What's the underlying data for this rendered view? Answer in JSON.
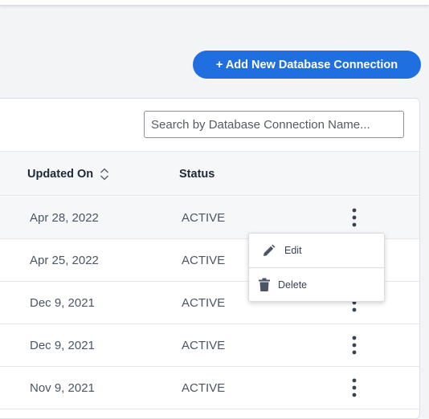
{
  "toolbar": {
    "add_label": "+ Add New Database Connection"
  },
  "search": {
    "placeholder": "Search by Database Connection Name..."
  },
  "table": {
    "columns": {
      "updated_on": "Updated On",
      "status": "Status"
    },
    "rows": [
      {
        "updated_on": "Apr 28, 2022",
        "status": "ACTIVE"
      },
      {
        "updated_on": "Apr 25, 2022",
        "status": "ACTIVE"
      },
      {
        "updated_on": "Dec 9, 2021",
        "status": "ACTIVE"
      },
      {
        "updated_on": "Dec 9, 2021",
        "status": "ACTIVE"
      },
      {
        "updated_on": "Nov 9, 2021",
        "status": "ACTIVE"
      }
    ]
  },
  "row_menu": {
    "edit_label": "Edit",
    "delete_label": "Delete"
  },
  "icons": {
    "sort": "sort-icon",
    "more": "more-vertical-icon",
    "edit": "pencil-icon",
    "delete": "trash-icon"
  },
  "colors": {
    "accent": "#1f6fe0"
  }
}
